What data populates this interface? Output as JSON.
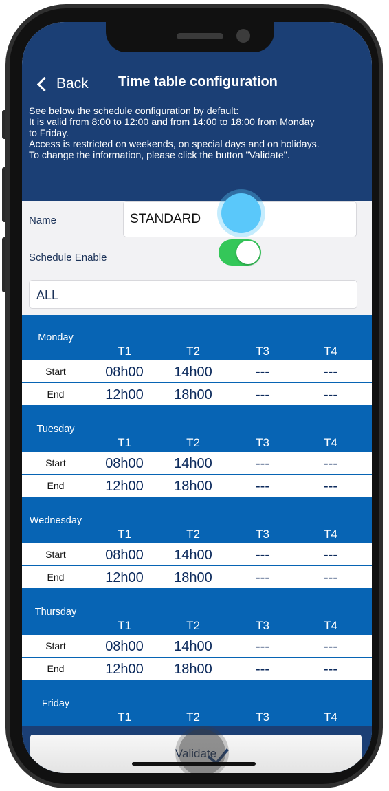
{
  "nav": {
    "back_label": "Back",
    "title": "Time table configuration"
  },
  "intro": {
    "lines": [
      "See below the schedule configuration by default:",
      " It is valid from 8:00 to 12:00 and from 14:00 to 18:00 from Monday",
      "to Friday.",
      " Access is restricted on weekends, on special days and on holidays.",
      " To change the information, please click the button \"Validate\"."
    ]
  },
  "form": {
    "name_label": "Name",
    "name_value": "STANDARD",
    "schedule_label": "Schedule Enable",
    "schedule_enabled": true,
    "all_value": "ALL"
  },
  "columns": [
    "T1",
    "T2",
    "T3",
    "T4"
  ],
  "row_labels": {
    "start": "Start",
    "end": "End"
  },
  "days": [
    {
      "name": "Monday",
      "start": [
        "08h00",
        "14h00",
        "---",
        "---"
      ],
      "end": [
        "12h00",
        "18h00",
        "---",
        "---"
      ]
    },
    {
      "name": "Tuesday",
      "start": [
        "08h00",
        "14h00",
        "---",
        "---"
      ],
      "end": [
        "12h00",
        "18h00",
        "---",
        "---"
      ]
    },
    {
      "name": "Wednesday",
      "start": [
        "08h00",
        "14h00",
        "---",
        "---"
      ],
      "end": [
        "12h00",
        "18h00",
        "---",
        "---"
      ]
    },
    {
      "name": "Thursday",
      "start": [
        "08h00",
        "14h00",
        "---",
        "---"
      ],
      "end": [
        "12h00",
        "18h00",
        "---",
        "---"
      ]
    },
    {
      "name": "Friday",
      "start": [],
      "end": []
    }
  ],
  "validate": {
    "label": "Validate"
  },
  "colors": {
    "header": "#1b3f75",
    "day_header": "#0764b4",
    "toggle_on": "#34c759",
    "touch": "#5ac8fa"
  }
}
